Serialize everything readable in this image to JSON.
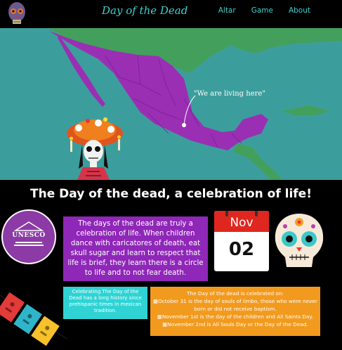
{
  "header": {
    "title": "Day of the Dead",
    "nav": [
      {
        "label": "Altar"
      },
      {
        "label": "Game"
      },
      {
        "label": "About"
      }
    ]
  },
  "hero": {
    "map_label": "\"We are living here\"",
    "colors": {
      "sea": "#3c9e9c",
      "land_us": "#43a05c",
      "mexico": "#9a2fb4"
    }
  },
  "headline": "The Day of the dead, a celebration of life!",
  "unesco": {
    "label": "UNESCO"
  },
  "days_box": {
    "text": "The days of the dead are truly a celebration of life. When children dance with caricatores of death, eat skull sugar and learn to respect that life is brief, they learn there is a circle to life and to not fear death."
  },
  "calendar": {
    "month": "Nov",
    "day": "02"
  },
  "history_box": {
    "text": "Celebrating The Day of the Dead has a long history since prehispanic times in mexican tradition."
  },
  "dates_box": {
    "title": "The Day of the dead is celebrated on:",
    "items": [
      "October 31 is the day of souls of limbo, those who were never born or did not receive baptism.",
      "November 1st is the day of the children and All Saints Day.",
      "November 2nd is All Souls Day or the Day of the Dead."
    ]
  }
}
